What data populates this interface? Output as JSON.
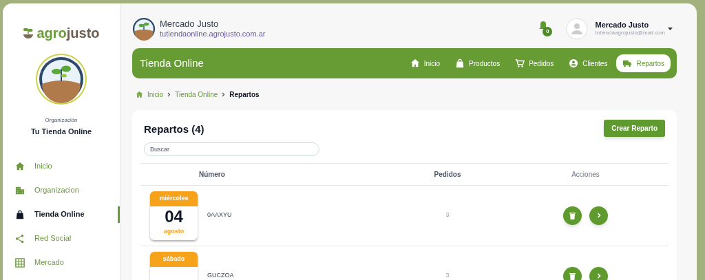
{
  "sidebar": {
    "logo": {
      "part_1": "agro",
      "part_2": "justo"
    },
    "organization_label": "Organización",
    "organization_name": "Tu Tienda Online",
    "items": [
      {
        "label": "Inicio",
        "selected": false
      },
      {
        "label": "Organizacion",
        "selected": false
      },
      {
        "label": "Tienda Online",
        "selected": true
      },
      {
        "label": "Red Social",
        "selected": false
      },
      {
        "label": "Mercado",
        "selected": false
      }
    ]
  },
  "header": {
    "store_name": "Mercado Justo",
    "store_url": "tutiendaonline.agrojusto.com.ar",
    "notifications": "0",
    "user_name": "Mercado Justo",
    "user_email": "tutiendaagrojusto@mail.com"
  },
  "nav_bar": {
    "title": "Tienda Online",
    "tabs": [
      {
        "label": "Inicio",
        "selected": false
      },
      {
        "label": "Productos",
        "selected": false
      },
      {
        "label": "Pedidos",
        "selected": false
      },
      {
        "label": "Clientes",
        "selected": false
      },
      {
        "label": "Repartos",
        "selected": true
      }
    ]
  },
  "breadcrumb": [
    {
      "label": "Inicio",
      "current": false
    },
    {
      "label": "Tienda Online",
      "current": false
    },
    {
      "label": "Repartos",
      "current": true
    }
  ],
  "card": {
    "title": "Repartos (4)",
    "create_button": "Crear Reparto",
    "search": {
      "placeholder": "Buscar"
    },
    "table": {
      "columns": [
        "Número",
        "Pedidos",
        "Acciones"
      ],
      "rows": [
        {
          "weekday": "miércoles",
          "day": "04",
          "month": "agosto",
          "number": "0AAXYU",
          "orders": "3"
        },
        {
          "weekday": "sábado",
          "number": "GUCZOA",
          "orders": "3"
        }
      ]
    }
  }
}
